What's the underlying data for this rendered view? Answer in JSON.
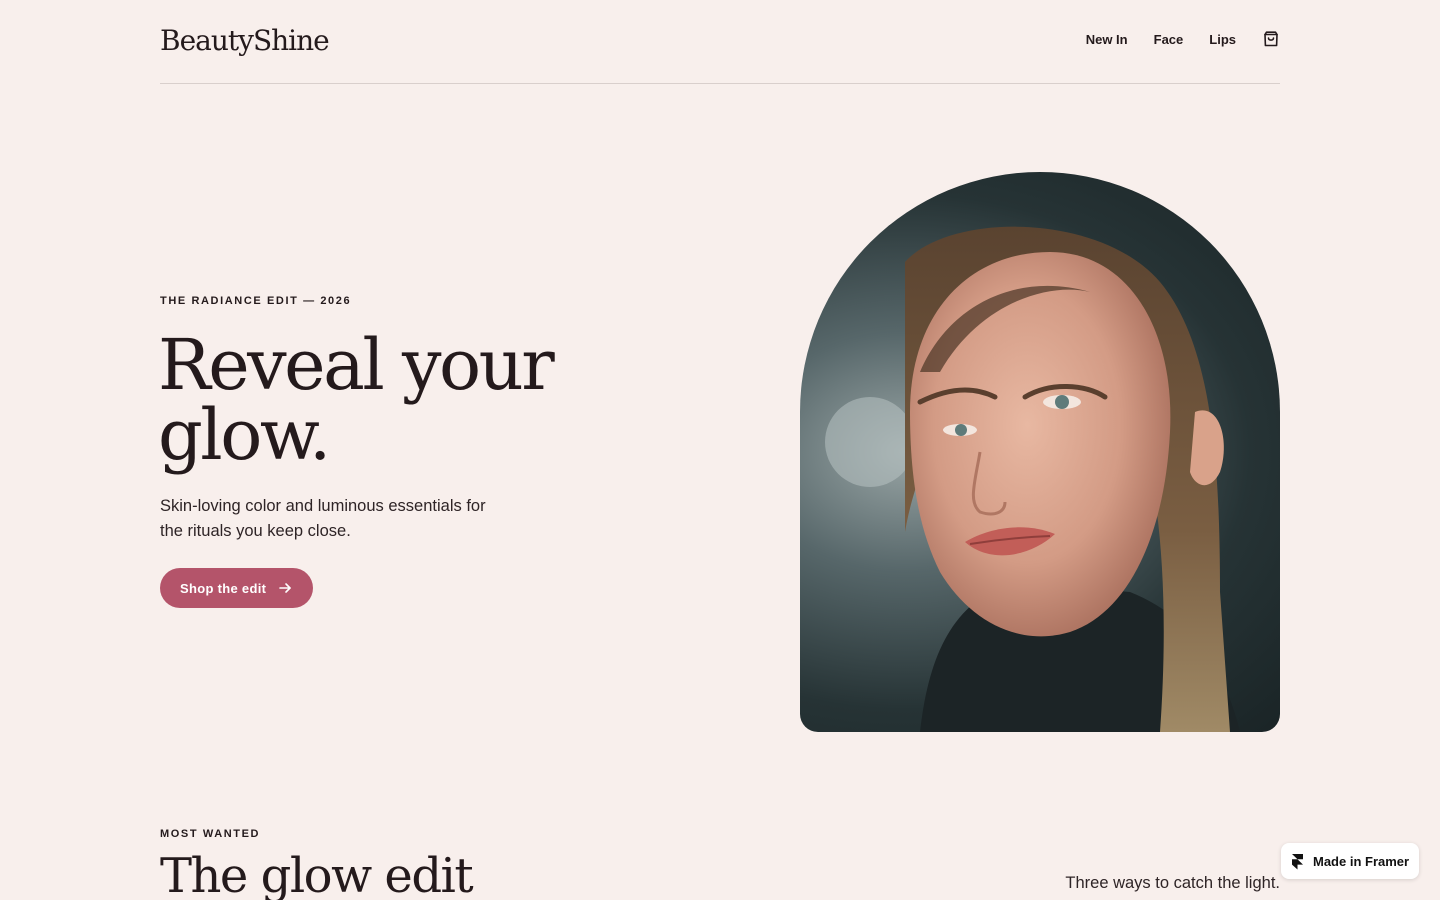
{
  "brand": {
    "logo": "BeautyShine"
  },
  "nav": {
    "items": [
      {
        "label": "New In"
      },
      {
        "label": "Face"
      },
      {
        "label": "Lips"
      }
    ],
    "cart_icon": "shopping-bag-icon"
  },
  "hero": {
    "eyebrow": "THE RADIANCE EDIT — 2026",
    "title": "Reveal your glow.",
    "subtitle": "Skin-loving color and luminous essentials for the rituals you keep close.",
    "cta_label": "Shop the edit",
    "cta_icon": "arrow-right-icon",
    "image_alt": "portrait-photo"
  },
  "section": {
    "eyebrow": "MOST WANTED",
    "title": "The glow edit",
    "subtitle": "Three ways to catch the light."
  },
  "badge": {
    "label": "Made in Framer",
    "icon": "framer-logo-icon"
  },
  "colors": {
    "background": "#f8efec",
    "text": "#241a1c",
    "accent": "#b4546a",
    "divider": "#d9cfcc"
  }
}
